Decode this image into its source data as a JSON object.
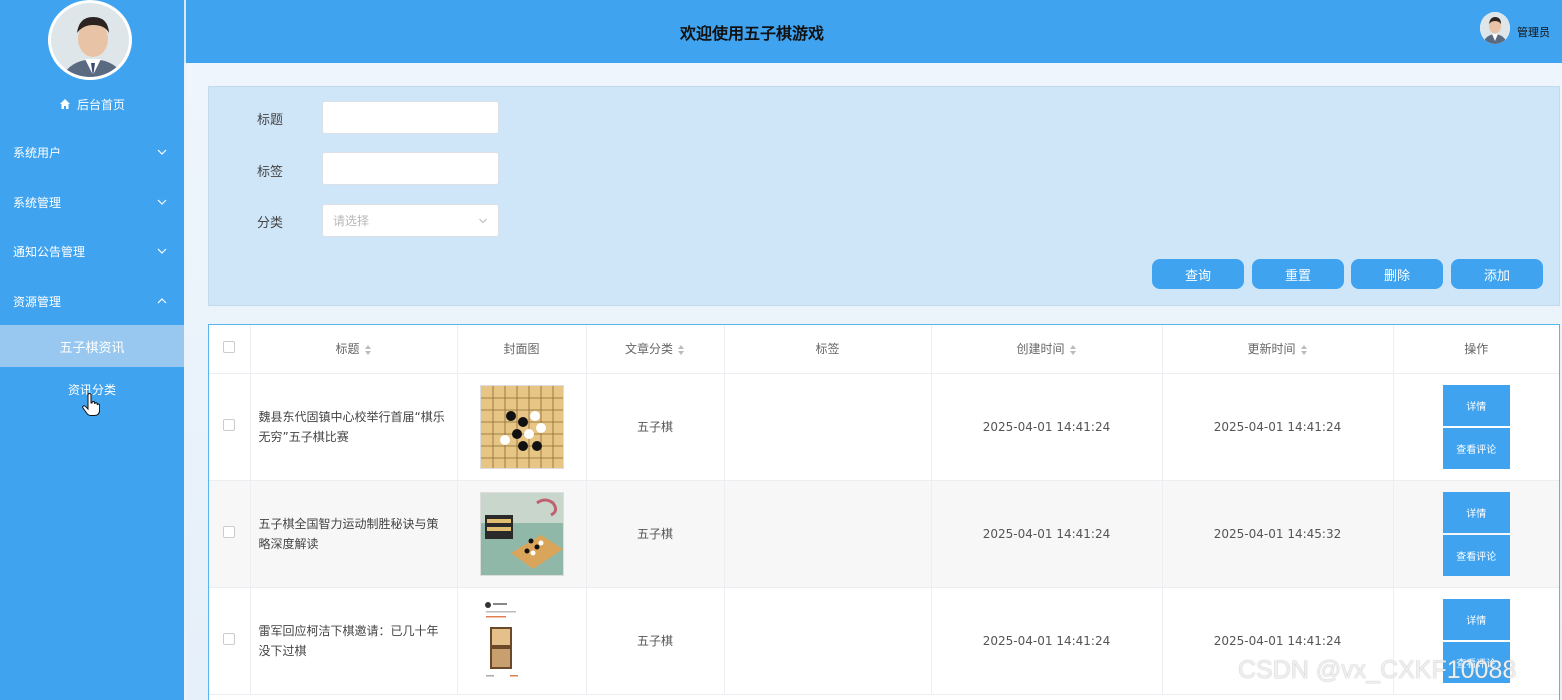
{
  "header": {
    "title": "欢迎使用五子棋游戏",
    "user": "管理员"
  },
  "sidebar": {
    "home": "后台首页",
    "menus": [
      {
        "label": "系统用户",
        "expanded": false
      },
      {
        "label": "系统管理",
        "expanded": false
      },
      {
        "label": "通知公告管理",
        "expanded": false
      },
      {
        "label": "资源管理",
        "expanded": true
      }
    ],
    "sub_items": [
      {
        "label": "五子棋资讯",
        "active": true
      },
      {
        "label": "资讯分类",
        "active": false
      }
    ]
  },
  "search": {
    "title_label": "标题",
    "title_value": "",
    "tag_label": "标签",
    "tag_value": "",
    "category_label": "分类",
    "category_placeholder": "请选择",
    "buttons": {
      "query": "查询",
      "reset": "重置",
      "delete": "删除",
      "add": "添加"
    }
  },
  "table": {
    "headers": {
      "title": "标题",
      "cover": "封面图",
      "category": "文章分类",
      "tags": "标签",
      "created": "创建时间",
      "updated": "更新时间",
      "actions": "操作"
    },
    "rows": [
      {
        "title": "魏县东代固镇中心校举行首届“棋乐无穷”五子棋比赛",
        "category": "五子棋",
        "tags": "",
        "created": "2025-04-01 14:41:24",
        "updated": "2025-04-01 14:41:24",
        "detail": "详情",
        "comments": "查看评论"
      },
      {
        "title": "五子棋全国智力运动制胜秘诀与策略深度解读",
        "category": "五子棋",
        "tags": "",
        "created": "2025-04-01 14:41:24",
        "updated": "2025-04-01 14:45:32",
        "detail": "详情",
        "comments": "查看评论"
      },
      {
        "title": "雷军回应柯洁下棋邀请：已几十年没下过棋",
        "category": "五子棋",
        "tags": "",
        "created": "2025-04-01 14:41:24",
        "updated": "2025-04-01 14:41:24",
        "detail": "详情",
        "comments": "查看评论"
      }
    ]
  },
  "watermark": "CSDN @vx_CXKF10088",
  "colors": {
    "primary": "#3fa3f0",
    "active_sub": "#98c7ef",
    "panel": "#cfe6f9"
  }
}
